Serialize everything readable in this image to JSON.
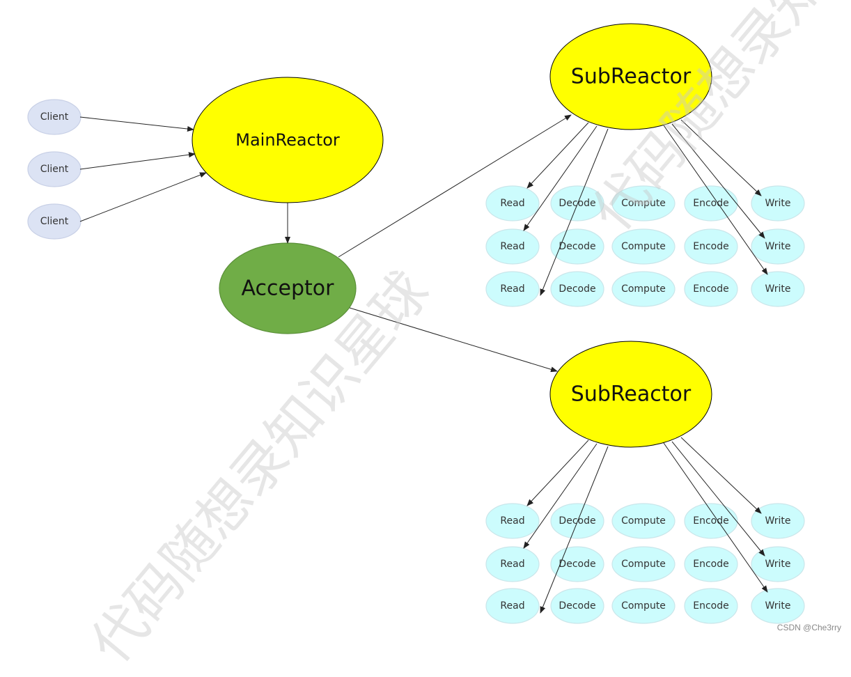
{
  "colors": {
    "reactor": "#ffff00",
    "acceptor": "#70ad47",
    "client": "#dce3f4",
    "worker": "#ccfcfd",
    "edge": "#222222"
  },
  "nodes": {
    "client1": {
      "label": "Client",
      "kind": "client"
    },
    "client2": {
      "label": "Client",
      "kind": "client"
    },
    "client3": {
      "label": "Client",
      "kind": "client"
    },
    "main": {
      "label": "MainReactor",
      "kind": "reactor"
    },
    "acceptor": {
      "label": "Acceptor",
      "kind": "acceptor"
    },
    "sub1": {
      "label": "SubReactor",
      "kind": "reactor"
    },
    "sub2": {
      "label": "SubReactor",
      "kind": "reactor"
    }
  },
  "worker_columns": [
    "Read",
    "Decode",
    "Compute",
    "Encode",
    "Write"
  ],
  "worker_groups": [
    {
      "reactor": "sub1",
      "rows": 3
    },
    {
      "reactor": "sub2",
      "rows": 3
    }
  ],
  "edges": [
    {
      "from": "client1",
      "to": "main"
    },
    {
      "from": "client2",
      "to": "main"
    },
    {
      "from": "client3",
      "to": "main"
    },
    {
      "from": "main",
      "to": "acceptor"
    },
    {
      "from": "acceptor",
      "to": "sub1"
    },
    {
      "from": "acceptor",
      "to": "sub2"
    },
    {
      "from": "sub1",
      "to": "sub1.Read.0"
    },
    {
      "from": "sub1",
      "to": "sub1.Read.1"
    },
    {
      "from": "sub1",
      "to": "sub1.Read.2"
    },
    {
      "from": "sub1",
      "to": "sub1.Write.0"
    },
    {
      "from": "sub1",
      "to": "sub1.Write.1"
    },
    {
      "from": "sub1",
      "to": "sub1.Write.2"
    },
    {
      "from": "sub2",
      "to": "sub2.Read.0"
    },
    {
      "from": "sub2",
      "to": "sub2.Read.1"
    },
    {
      "from": "sub2",
      "to": "sub2.Read.2"
    },
    {
      "from": "sub2",
      "to": "sub2.Write.0"
    },
    {
      "from": "sub2",
      "to": "sub2.Write.1"
    },
    {
      "from": "sub2",
      "to": "sub2.Write.2"
    }
  ],
  "watermark": "代码随想录知识星球",
  "credit": "CSDN @Che3rry"
}
